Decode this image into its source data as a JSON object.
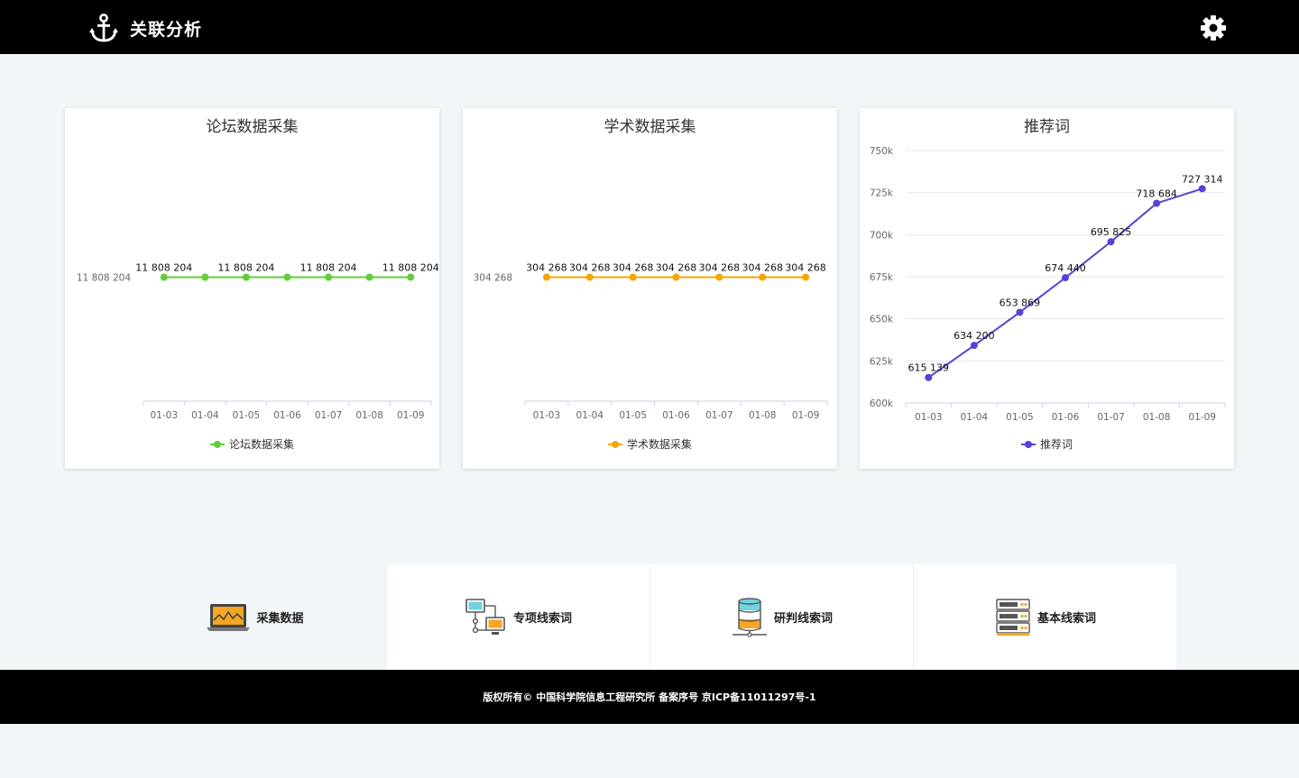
{
  "header": {
    "title": "关联分析",
    "logo_icon": "anchor-icon",
    "settings_icon": "gear-icon"
  },
  "colors": {
    "green": "#5fce3a",
    "orange": "#f5a500",
    "purple": "#5b3fd6"
  },
  "charts": [
    {
      "title": "论坛数据采集",
      "legend": "论坛数据采集",
      "y_tick_label": "11 808 204",
      "point_labels": [
        "11 808 204",
        "11 808 204",
        "11 808 204",
        "11 808 204"
      ]
    },
    {
      "title": "学术数据采集",
      "legend": "学术数据采集",
      "y_tick_label": "304 268",
      "point_labels": [
        "304 268",
        "304 268",
        "304 268",
        "304 268",
        "304 268",
        "304 268",
        "304 268"
      ]
    },
    {
      "title": "推荐词",
      "legend": "推荐词",
      "y_tick_labels": [
        "750k",
        "725k",
        "700k",
        "675k",
        "650k",
        "625k",
        "600k"
      ],
      "point_labels": [
        "615 139",
        "634 200",
        "653 869",
        "674 440",
        "695 825",
        "718 684",
        "727 314"
      ]
    }
  ],
  "chart_data": [
    {
      "type": "line",
      "title": "论坛数据采集",
      "categories": [
        "01-03",
        "01-04",
        "01-05",
        "01-06",
        "01-07",
        "01-08",
        "01-09"
      ],
      "series": [
        {
          "name": "论坛数据采集",
          "values": [
            11808204,
            11808204,
            11808204,
            11808204,
            11808204,
            11808204,
            11808204
          ],
          "color": "#5fce3a"
        }
      ]
    },
    {
      "type": "line",
      "title": "学术数据采集",
      "categories": [
        "01-03",
        "01-04",
        "01-05",
        "01-06",
        "01-07",
        "01-08",
        "01-09"
      ],
      "series": [
        {
          "name": "学术数据采集",
          "values": [
            304268,
            304268,
            304268,
            304268,
            304268,
            304268,
            304268
          ],
          "color": "#f5a500"
        }
      ]
    },
    {
      "type": "line",
      "title": "推荐词",
      "categories": [
        "01-03",
        "01-04",
        "01-05",
        "01-06",
        "01-07",
        "01-08",
        "01-09"
      ],
      "series": [
        {
          "name": "推荐词",
          "values": [
            615139,
            634200,
            653869,
            674440,
            695825,
            718684,
            727314
          ],
          "color": "#5b3fd6"
        }
      ],
      "ylim": [
        600000,
        750000
      ],
      "grid": true
    }
  ],
  "nav": [
    {
      "label": "采集数据",
      "icon": "laptop-chart-icon"
    },
    {
      "label": "专项线索词",
      "icon": "network-computers-icon"
    },
    {
      "label": "研判线索词",
      "icon": "database-icon"
    },
    {
      "label": "基本线索词",
      "icon": "server-rack-icon"
    }
  ],
  "footer": {
    "text": "版权所有© 中国科学院信息工程研究所 备案序号 京ICP备11011297号-1"
  }
}
